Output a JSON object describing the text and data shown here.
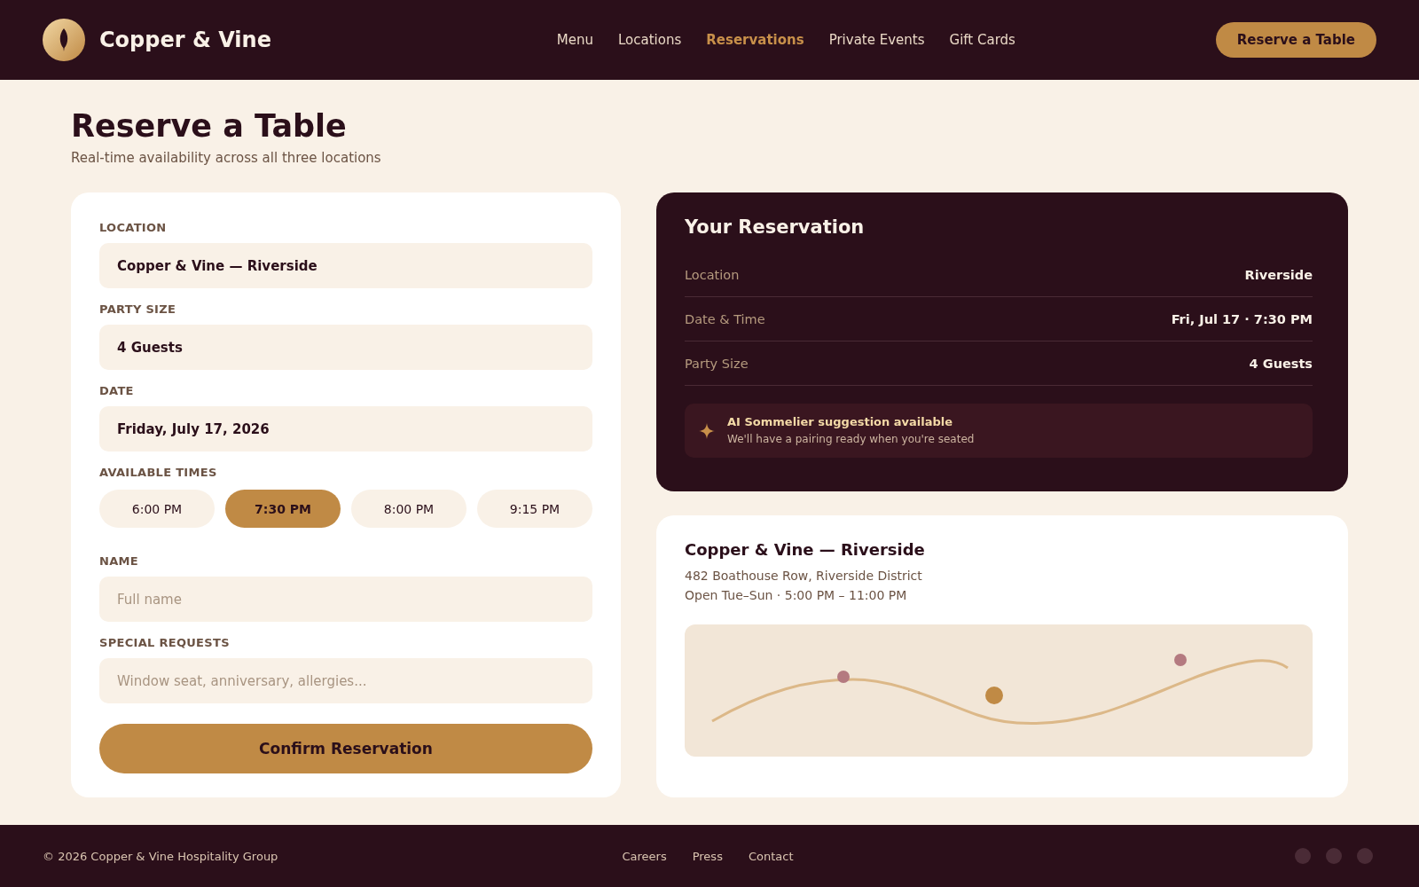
{
  "header": {
    "brand": "Copper & Vine",
    "nav": [
      {
        "label": "Menu",
        "selected": false
      },
      {
        "label": "Locations",
        "selected": false
      },
      {
        "label": "Reservations",
        "selected": true
      },
      {
        "label": "Private Events",
        "selected": false
      },
      {
        "label": "Gift Cards",
        "selected": false
      }
    ],
    "cta": "Reserve a Table"
  },
  "page": {
    "title": "Reserve a Table",
    "subtitle": "Real-time availability across all three locations"
  },
  "form": {
    "fields": [
      {
        "kind": "select",
        "label": "LOCATION",
        "value": "Copper & Vine — Riverside"
      },
      {
        "kind": "select",
        "label": "PARTY SIZE",
        "value": "4 Guests"
      },
      {
        "kind": "select",
        "label": "DATE",
        "value": "Friday, July 17, 2026"
      },
      {
        "kind": "times",
        "label": "AVAILABLE TIMES",
        "options": [
          {
            "label": "6:00 PM",
            "selected": false
          },
          {
            "label": "7:30 PM",
            "selected": true
          },
          {
            "label": "8:00 PM",
            "selected": false
          },
          {
            "label": "9:15 PM",
            "selected": false
          }
        ]
      },
      {
        "kind": "text",
        "label": "NAME",
        "placeholder": "Full name"
      },
      {
        "kind": "text",
        "label": "SPECIAL REQUESTS",
        "placeholder": "Window seat, anniversary, allergies..."
      }
    ],
    "submit": "Confirm Reservation"
  },
  "summary": {
    "title": "Your Reservation",
    "rows": [
      {
        "label": "Location",
        "value": "Riverside"
      },
      {
        "label": "Date & Time",
        "value": "Fri, Jul 17 · 7:30 PM"
      },
      {
        "label": "Party Size",
        "value": "4 Guests"
      }
    ],
    "note": {
      "title": "AI Sommelier suggestion available",
      "text": "We'll have a pairing ready when you're seated"
    }
  },
  "location_card": {
    "name": "Copper & Vine — Riverside",
    "address": "482 Boathouse Row, Riverside District",
    "hours": "Open Tue–Sun · 5:00 PM – 11:00 PM"
  },
  "footer": {
    "copyright": "© 2026 Copper & Vine Hospitality Group",
    "links": [
      "Careers",
      "Press",
      "Contact"
    ]
  }
}
